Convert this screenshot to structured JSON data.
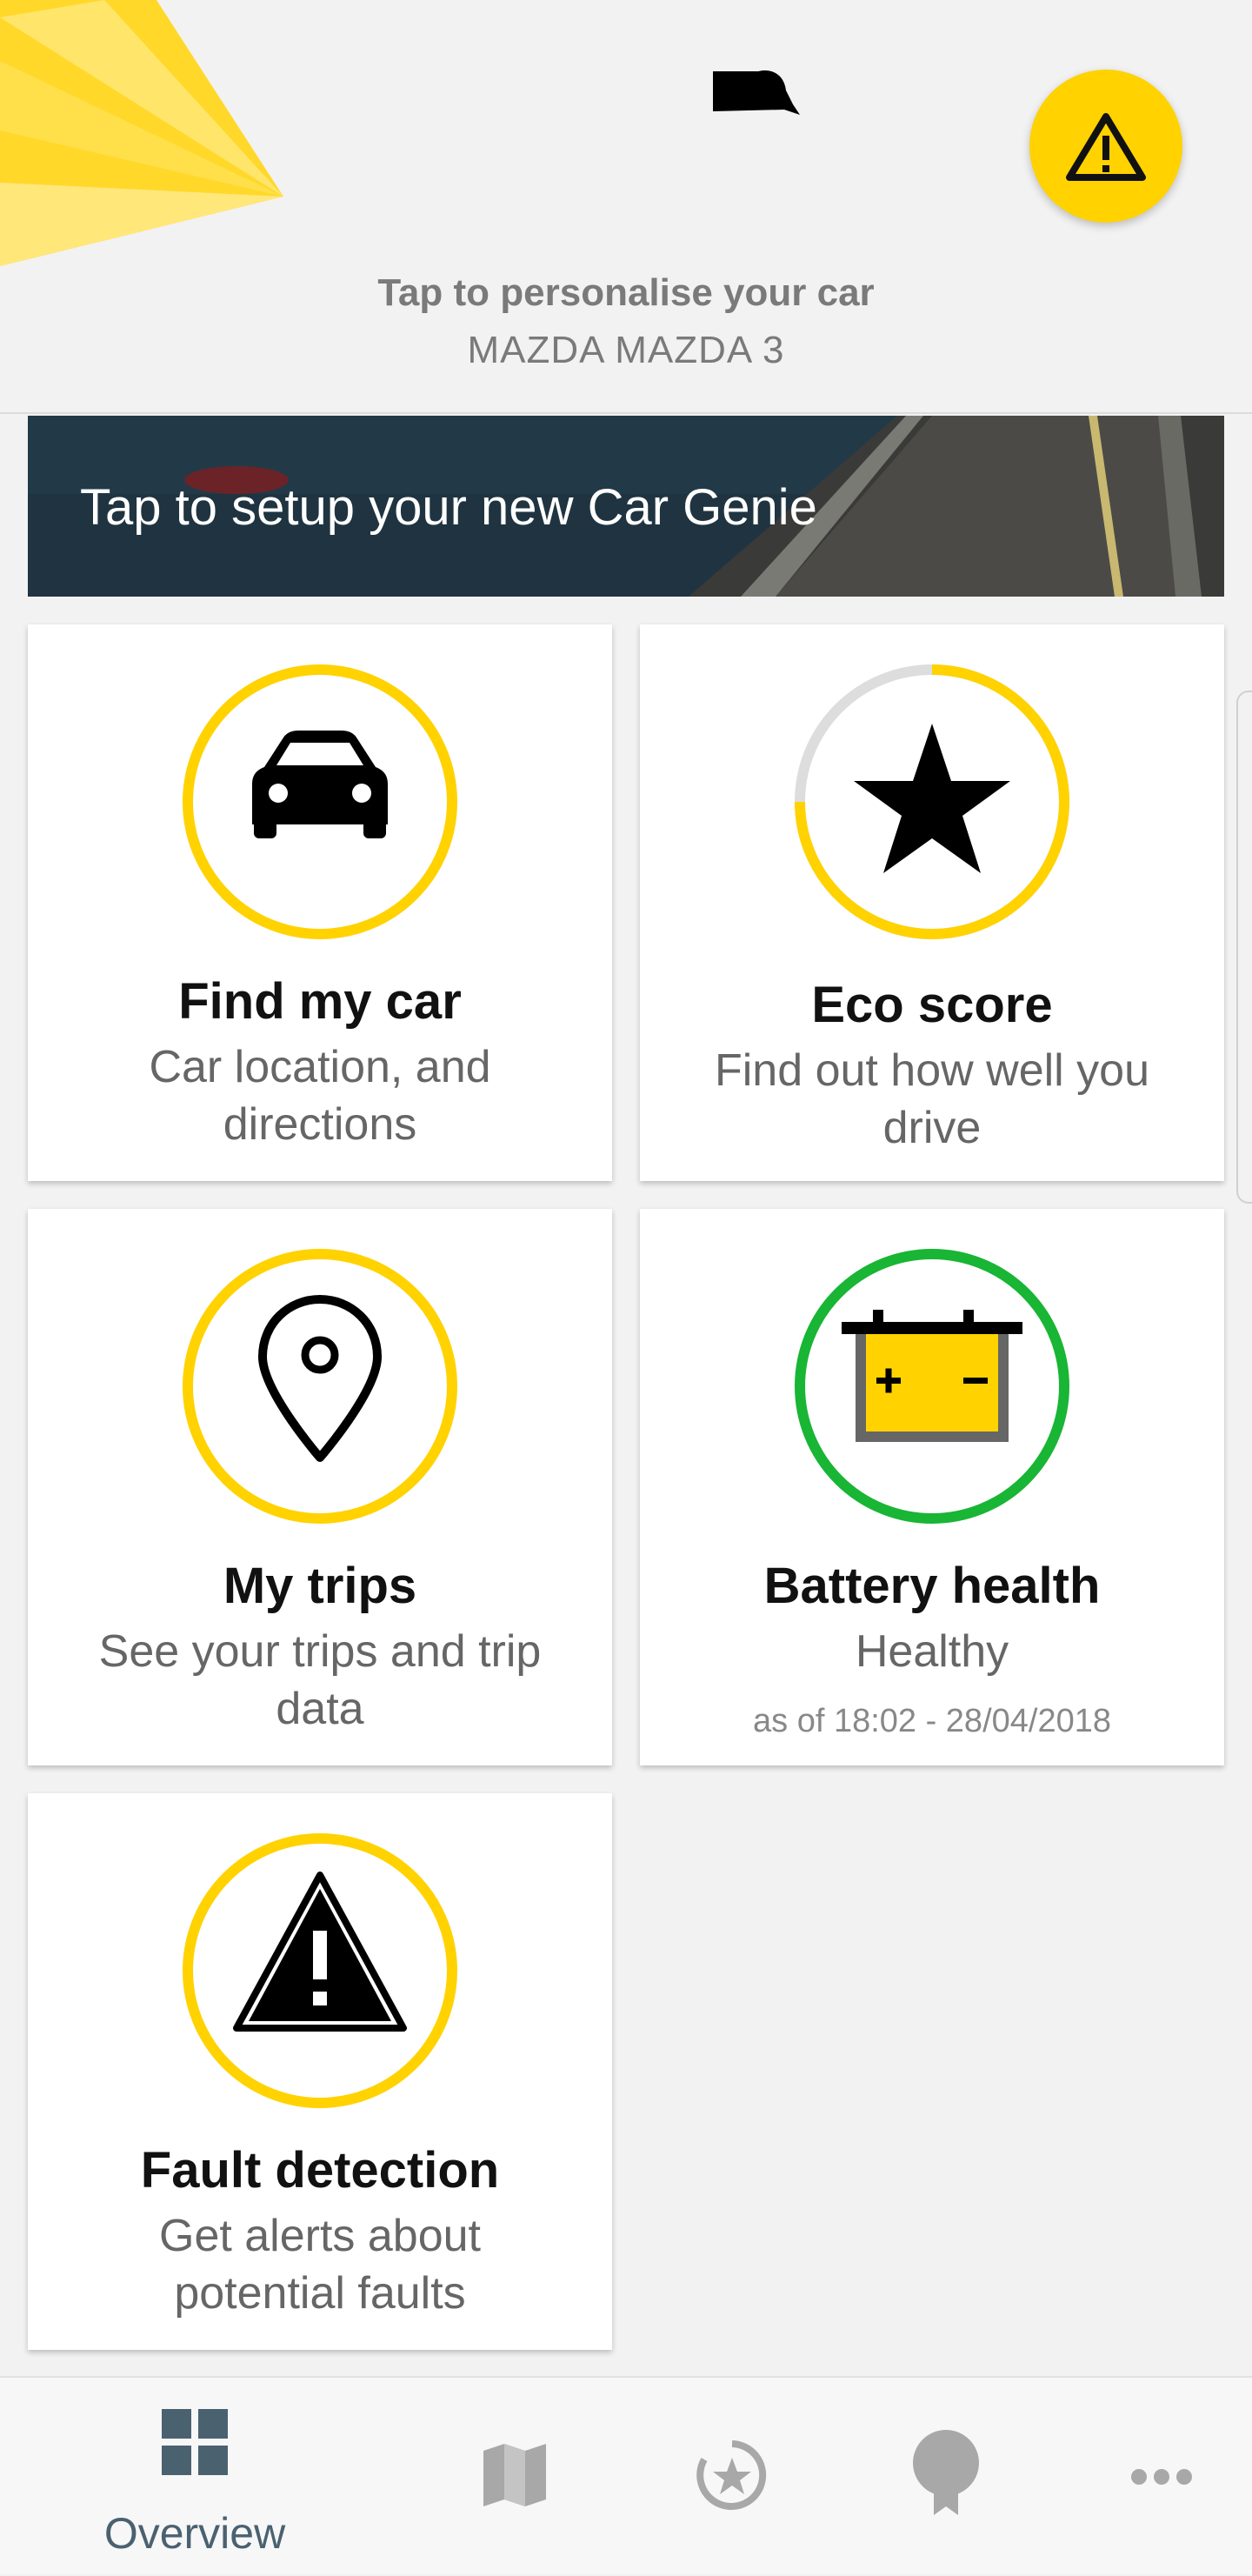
{
  "header": {
    "personalise_title": "Tap to personalise your car",
    "car_model": "MAZDA MAZDA 3",
    "alert_icon": "warning-triangle-icon",
    "accent_color": "#ffd200"
  },
  "banner": {
    "text": "Tap to setup your new Car Genie"
  },
  "cards": [
    {
      "title": "Find my car",
      "description": "Car location, and directions",
      "icon": "car-icon",
      "ring_color": "#ffd200"
    },
    {
      "title": "Eco score",
      "description": "Find out how well you drive",
      "icon": "star-icon",
      "ring_color": "#ffd200"
    },
    {
      "title": "My trips",
      "description": "See your trips and trip data",
      "icon": "location-pin-icon",
      "ring_color": "#ffd200"
    },
    {
      "title": "Battery health",
      "description": "Healthy",
      "timestamp": "as of 18:02 - 28/04/2018",
      "icon": "battery-icon",
      "ring_color": "#19b534"
    },
    {
      "title": "Fault detection",
      "description": "Get alerts about potential faults",
      "icon": "warning-icon",
      "ring_color": "#ffd200"
    }
  ],
  "nav": {
    "items": [
      {
        "label": "Overview",
        "icon": "grid-icon",
        "active": true
      },
      {
        "icon": "map-icon"
      },
      {
        "icon": "eco-score-icon"
      },
      {
        "icon": "award-icon"
      },
      {
        "icon": "more-icon"
      }
    ],
    "active_color": "#4a6170",
    "inactive_color": "#a8a8a8"
  }
}
